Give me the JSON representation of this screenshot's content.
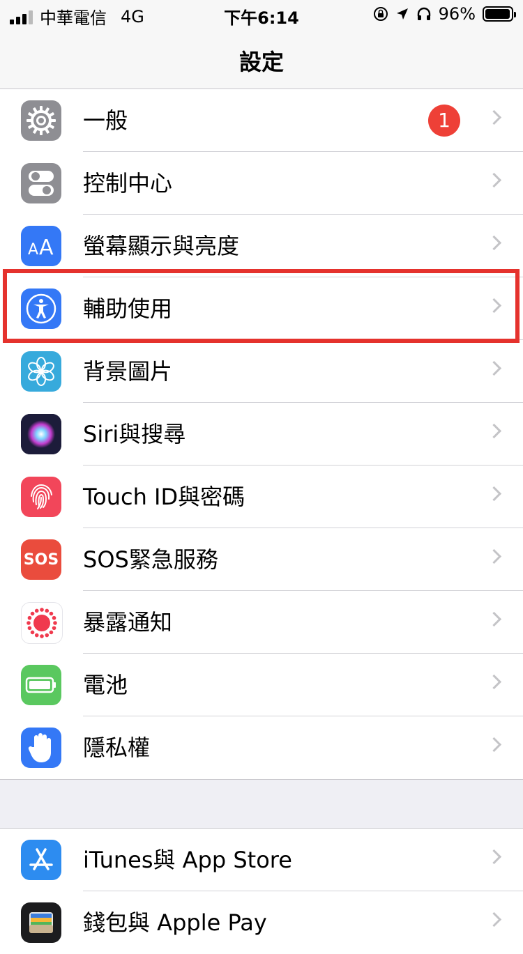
{
  "status_bar": {
    "carrier": "中華電信",
    "network": "4G",
    "time": "下午6:14",
    "battery": "96%",
    "battery_level": 0.96
  },
  "nav": {
    "title": "設定"
  },
  "settings_group_1": [
    {
      "label": "一般",
      "icon": "gear-icon",
      "color": "#8e8e93",
      "badge": "1"
    },
    {
      "label": "控制中心",
      "icon": "switches-icon",
      "color": "#8e8e93"
    },
    {
      "label": "螢幕顯示與亮度",
      "icon": "text-size-icon",
      "color": "#3478f6"
    },
    {
      "label": "輔助使用",
      "icon": "accessibility-icon",
      "color": "#3478f6"
    },
    {
      "label": "背景圖片",
      "icon": "flower-icon",
      "color": "#37aadc"
    },
    {
      "label": "Siri與搜尋",
      "icon": "siri-icon",
      "color": "#1c1c3a"
    },
    {
      "label": "Touch ID與密碼",
      "icon": "fingerprint-icon",
      "color": "#f2465a"
    },
    {
      "label": "SOS緊急服務",
      "icon": "sos-icon",
      "color": "#ea4c3d",
      "icon_text": "SOS"
    },
    {
      "label": "暴露通知",
      "icon": "exposure-icon",
      "color": "#ffffff"
    },
    {
      "label": "電池",
      "icon": "battery-icon",
      "color": "#5ac85f"
    },
    {
      "label": "隱私權",
      "icon": "hand-icon",
      "color": "#3478f6"
    }
  ],
  "settings_group_2": [
    {
      "label": "iTunes與 App Store",
      "icon": "app-store-icon",
      "color": "#2d8cf0"
    },
    {
      "label": "錢包與 Apple Pay",
      "icon": "wallet-icon",
      "color": "#1c1c1e"
    }
  ],
  "accent_color": "#3478f6",
  "highlight_color": "#e5322d"
}
